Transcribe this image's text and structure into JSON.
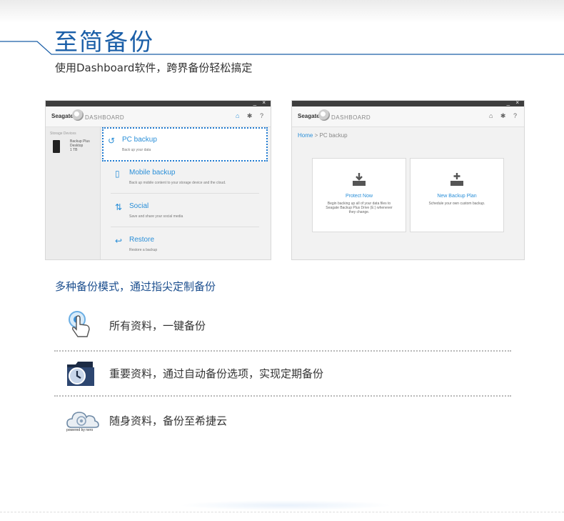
{
  "header": {
    "title": "至简备份",
    "subtitle": "使用Dashboard软件，跨界备份轻松搞定"
  },
  "window1": {
    "controls": "_ ×",
    "brand": "Seagate",
    "app_name": "DASHBOARD",
    "sidebar_label": "Storage Devices",
    "device_name": "Backup Plus Desktop",
    "device_size": "1 TB",
    "menu": [
      {
        "icon": "undo-arrow-icon",
        "title": "PC backup",
        "desc": "Back up your data"
      },
      {
        "icon": "tablet-icon",
        "title": "Mobile backup",
        "desc": "Back up mobile content to your storage device and the cloud."
      },
      {
        "icon": "share-arrows-icon",
        "title": "Social",
        "desc": "Save and share your social media"
      },
      {
        "icon": "restore-arrow-icon",
        "title": "Restore",
        "desc": "Restore a backup"
      }
    ]
  },
  "window2": {
    "controls": "_ ×",
    "brand": "Seagate",
    "app_name": "DASHBOARD",
    "breadcrumb_home": "Home",
    "breadcrumb_sep": ">",
    "breadcrumb_current": "PC backup",
    "cards": [
      {
        "icon": "download-drive-icon",
        "title": "Protect Now",
        "desc": "Begin backing up all of your data files to Seagate Backup Plus Drive (E:) whenever they change."
      },
      {
        "icon": "add-drive-icon",
        "title": "New Backup Plan",
        "desc": "Schedule your own custom backup."
      }
    ]
  },
  "features": {
    "title": "多种备份模式，通过指尖定制备份",
    "items": [
      {
        "icon": "touch-hand-icon",
        "text": "所有资料，一键备份"
      },
      {
        "icon": "clock-folder-icon",
        "text": "重要资料，通过自动备份选项，实现定期备份"
      },
      {
        "icon": "cloud-nero-icon",
        "text": "随身资料，备份至希捷云",
        "badge": "powered by nero"
      }
    ]
  },
  "colors": {
    "accent": "#1b5fa8",
    "link": "#2a8fd8",
    "dark_bar": "#3e3e3e"
  }
}
